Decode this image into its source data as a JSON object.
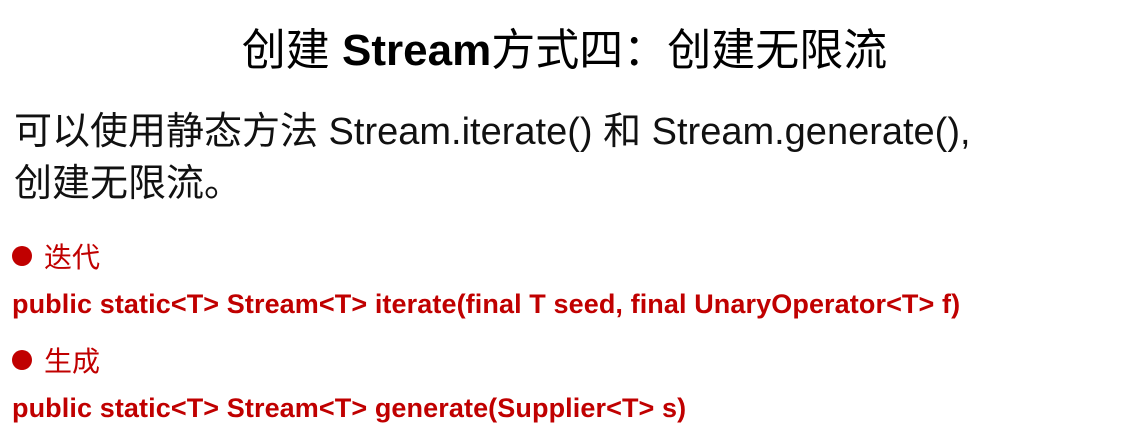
{
  "slide": {
    "title_prefix": "创建 ",
    "title_code": "Stream",
    "title_suffix": "方式四：创建无限流",
    "description_line1": "可以使用静态方法 Stream.iterate() 和 Stream.generate(),",
    "description_line2": "创建无限流。",
    "bullets": [
      {
        "label": "迭代",
        "signature": "public static<T> Stream<T> iterate(final T seed, final UnaryOperator<T> f)"
      },
      {
        "label": "生成",
        "signature": "public static<T> Stream<T> generate(Supplier<T> s)"
      }
    ]
  },
  "colors": {
    "accent_red": "#c00000",
    "text": "#111111",
    "background": "#ffffff"
  }
}
